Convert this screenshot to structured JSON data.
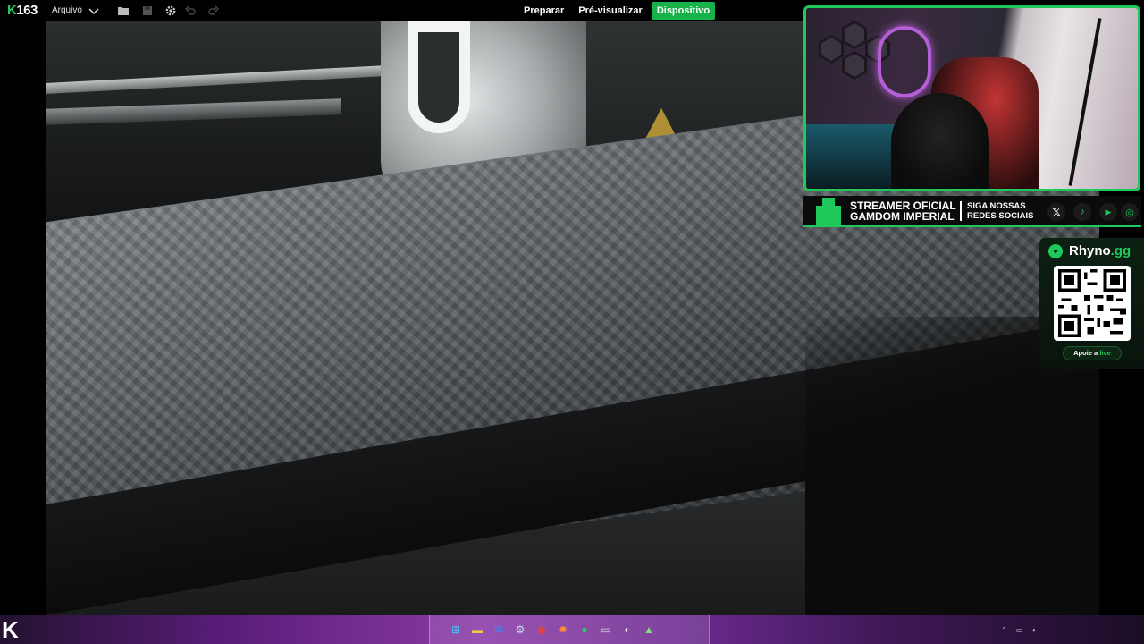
{
  "app": {
    "logo_text": "163",
    "file_menu": "Arquivo"
  },
  "tabs": [
    {
      "label": "Preparar",
      "active": false
    },
    {
      "label": "Pré-visualizar",
      "active": false
    },
    {
      "label": "Dispositivo",
      "active": true
    }
  ],
  "toolbar_icons": [
    "chevron-down-icon",
    "folder-open-icon",
    "save-icon",
    "gear-icon",
    "undo-icon",
    "redo-icon"
  ],
  "banner": {
    "line1": "STREAMER OFICIAL",
    "line2": "GAMDOM IMPERIAL",
    "follow1": "SIGA NOSSAS",
    "follow2": "REDES SOCIAIS",
    "socials": [
      {
        "name": "x-icon",
        "glyph": "𝕏",
        "color": "#ffffff"
      },
      {
        "name": "tiktok-icon",
        "glyph": "♪",
        "color": "#1ec85a"
      },
      {
        "name": "youtube-icon",
        "glyph": "▶",
        "color": "#1ec85a"
      },
      {
        "name": "instagram-icon",
        "glyph": "◎",
        "color": "#1ec85a"
      }
    ]
  },
  "rhyno": {
    "name": "Rhyno",
    "name_suffix": ".gg",
    "support": "Apoie a",
    "support_live": "live"
  },
  "colors": {
    "accent": "#1ec85a",
    "active_tab": "#17b24a"
  },
  "taskbar": {
    "apps": [
      "windows-start-icon",
      "file-explorer-icon",
      "outlook-icon",
      "steam-icon",
      "chrome-icon",
      "app-icon",
      "spotify-icon",
      "terminal-icon",
      "obs-icon",
      "app-icon-2"
    ]
  }
}
